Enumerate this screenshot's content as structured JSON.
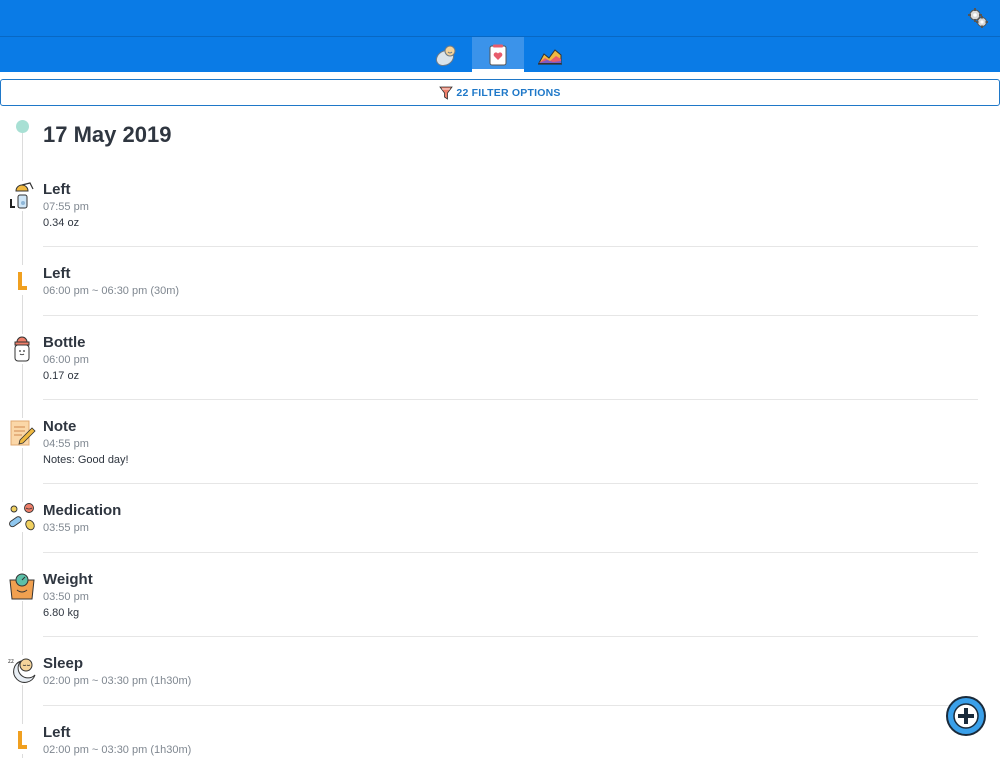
{
  "tabs": [
    {
      "name": "baby",
      "icon": "swaddled-baby-icon",
      "active": false
    },
    {
      "name": "log",
      "icon": "heart-journal-icon",
      "active": true
    },
    {
      "name": "chart",
      "icon": "area-chart-icon",
      "active": false
    }
  ],
  "filter": {
    "label": "22 FILTER OPTIONS",
    "icon": "filter-funnel-icon"
  },
  "date": "17 May 2019",
  "entries": [
    {
      "icon": "breast-pump-icon",
      "title": "Left",
      "time": "07:55 pm",
      "detail": "0.34 oz"
    },
    {
      "icon": "left-side-icon",
      "title": "Left",
      "time": "06:00 pm ~ 06:30 pm (30m)",
      "detail": ""
    },
    {
      "icon": "bottle-icon",
      "title": "Bottle",
      "time": "06:00 pm",
      "detail": "0.17 oz"
    },
    {
      "icon": "note-pencil-icon",
      "title": "Note",
      "time": "04:55 pm",
      "detail": "Notes: Good day!"
    },
    {
      "icon": "pills-icon",
      "title": "Medication",
      "time": "03:55 pm",
      "detail": ""
    },
    {
      "icon": "weight-scale-icon",
      "title": "Weight",
      "time": "03:50 pm",
      "detail": "6.80 kg"
    },
    {
      "icon": "sleep-moon-icon",
      "title": "Sleep",
      "time": "02:00 pm ~ 03:30 pm (1h30m)",
      "detail": ""
    },
    {
      "icon": "left-side-icon",
      "title": "Left",
      "time": "02:00 pm ~ 03:30 pm (1h30m)",
      "detail": ""
    }
  ],
  "colors": {
    "header": "#0a7be6",
    "accent": "#1f78c8",
    "timeline_dot": "#a8e0d4",
    "left_marker": "#f0a020"
  }
}
